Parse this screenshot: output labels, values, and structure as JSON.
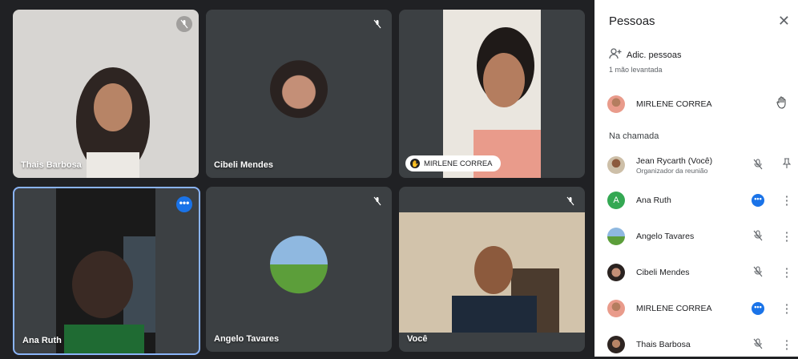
{
  "tiles": {
    "thais": {
      "name": "Thais Barbosa"
    },
    "cibeli": {
      "name": "Cibeli Mendes"
    },
    "mirlene": {
      "name": "MIRLENE CORREA"
    },
    "ana": {
      "name": "Ana Ruth"
    },
    "angelo": {
      "name": "Angelo Tavares"
    },
    "voce": {
      "name": "Você"
    }
  },
  "panel": {
    "title": "Pessoas",
    "close": "✕",
    "add_label": "Adic. pessoas",
    "hands_header": "1 mão levantada",
    "raised": {
      "name": "MIRLENE CORREA"
    },
    "in_call_header": "Na chamada",
    "participants": [
      {
        "name": "Jean Rycarth (Você)",
        "sub": "Organizador da reunião"
      },
      {
        "name": "Ana Ruth",
        "avatar_letter": "A"
      },
      {
        "name": "Angelo Tavares"
      },
      {
        "name": "Cibeli Mendes"
      },
      {
        "name": "MIRLENE CORREA"
      },
      {
        "name": "Thais Barbosa"
      }
    ]
  },
  "colors": {
    "accent": "#1a73e8",
    "tile": "#3c4043",
    "background": "#202124",
    "ana_avatar": "#34a853"
  }
}
